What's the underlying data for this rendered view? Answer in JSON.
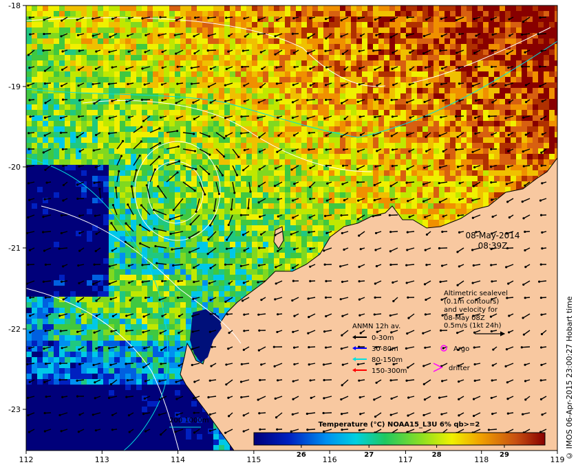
{
  "map": {
    "x_ticks": [
      "112",
      "113",
      "114",
      "115",
      "116",
      "117",
      "118",
      "119"
    ],
    "y_ticks": [
      "-18",
      "-19",
      "-20",
      "-21",
      "-22",
      "-23"
    ],
    "date": "08-May-2014",
    "time": "08:39Z"
  },
  "sealevel_note": {
    "line1": "Altimetric sealevel",
    "line2": "(0.1m contours)",
    "line3": "and velocity for",
    "line4": "08-May 08Z",
    "line5": "0.5m/s (1kt 24h)"
  },
  "mooring_legend": {
    "title": "ANMN 12h av.",
    "items": [
      {
        "label": "0-30m",
        "color": "#000000"
      },
      {
        "label": "30-80m",
        "color": "#0000ff"
      },
      {
        "label": "80-150m",
        "color": "#00e0e0"
      },
      {
        "label": "150-300m",
        "color": "#ff0000"
      }
    ]
  },
  "symbols": {
    "argo": {
      "label": "Argo",
      "color": "#ff00ff"
    },
    "drifter": {
      "label": "drifter",
      "color": "#ff00ff"
    }
  },
  "bathymetry": {
    "label": "200  1000m",
    "color": "#00e0e0"
  },
  "colorbar": {
    "title": "Temperature (°C) NOAA15_L3U 6% qb>=2",
    "ticks": [
      "26",
      "27",
      "28",
      "29"
    ],
    "tick_values": [
      26,
      27,
      28,
      29
    ],
    "range": [
      25.3,
      29.6
    ]
  },
  "colors": {
    "land": "#f8c8a0",
    "coastline": "#000000"
  },
  "side_note": "© IMOS 06-Apr-2015 23:00:27 Hobart time"
}
